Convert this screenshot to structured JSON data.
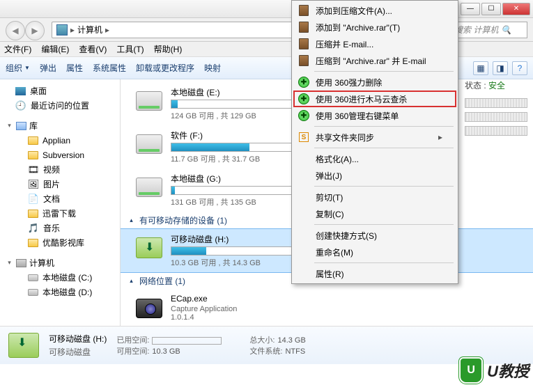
{
  "titlebar": {
    "min": "—",
    "max": "☐",
    "close": "✕"
  },
  "addr": {
    "location": "计算机",
    "search_ph": "搜索 计算机",
    "search_icon": "🔍"
  },
  "menu": [
    "文件(F)",
    "编辑(E)",
    "查看(V)",
    "工具(T)",
    "帮助(H)"
  ],
  "toolbar": {
    "org": "组织",
    "eject": "弹出",
    "prop": "属性",
    "sysprop": "系统属性",
    "uninstall": "卸载或更改程序",
    "map": "映射"
  },
  "nav": {
    "desktop": "桌面",
    "recent": "最近访问的位置",
    "lib": "库",
    "applian": "Applian",
    "svn": "Subversion",
    "video": "视频",
    "pic": "图片",
    "doc": "文档",
    "xunlei": "迅雷下载",
    "music": "音乐",
    "youku": "优酷影视库",
    "computer": "计算机",
    "cdisk": "本地磁盘 (C:)",
    "ddisk": "本地磁盘 (D:)"
  },
  "drives": {
    "e": {
      "name": "本地磁盘 (E:)",
      "detail": "124 GB 可用 , 共 129 GB",
      "fill": 5
    },
    "soft": {
      "name": "软件 (F:)",
      "detail": "11.7 GB 可用 , 共 31.7 GB",
      "fill": 63
    },
    "g": {
      "name": "本地磁盘 (G:)",
      "detail": "131 GB 可用 , 共 135 GB",
      "fill": 3
    },
    "section_removable": "有可移动存储的设备 (1)",
    "h": {
      "name": "可移动磁盘 (H:)",
      "detail": "10.3 GB 可用 , 共 14.3 GB",
      "fill": 28
    },
    "section_net": "网络位置 (1)",
    "ecap": {
      "name": "ECap.exe",
      "line2": "Capture Application",
      "line3": "1.0.1.4"
    }
  },
  "status": {
    "title": "可移动磁盘 (H:)",
    "sub": "可移动磁盘",
    "used_lbl": "已用空间:",
    "used_val": "",
    "free_lbl": "可用空间:",
    "free_val": "10.3 GB",
    "total_lbl": "总大小:",
    "total_val": "14.3 GB",
    "fs_lbl": "文件系统:",
    "fs_val": "NTFS"
  },
  "ctx": {
    "add_archive": "添加到压缩文件(A)...",
    "add_to_rar": "添加到 \"Archive.rar\"(T)",
    "compress_email": "压缩并 E-mail...",
    "compress_to_email": "压缩到 \"Archive.rar\" 并 E-mail",
    "force_del": "使用 360强力删除",
    "trojan_scan": "使用 360进行木马云查杀",
    "manage_menu": "使用 360管理右键菜单",
    "share_sync": "共享文件夹同步",
    "format": "格式化(A)...",
    "eject": "弹出(J)",
    "cut": "剪切(T)",
    "copy": "复制(C)",
    "shortcut": "创建快捷方式(S)",
    "rename": "重命名(M)",
    "props": "属性(R)"
  },
  "rightpanel": {
    "status_lbl": "状态 :",
    "status_val": "安全"
  },
  "watermark": {
    "logo": "U",
    "text": "U教授"
  }
}
